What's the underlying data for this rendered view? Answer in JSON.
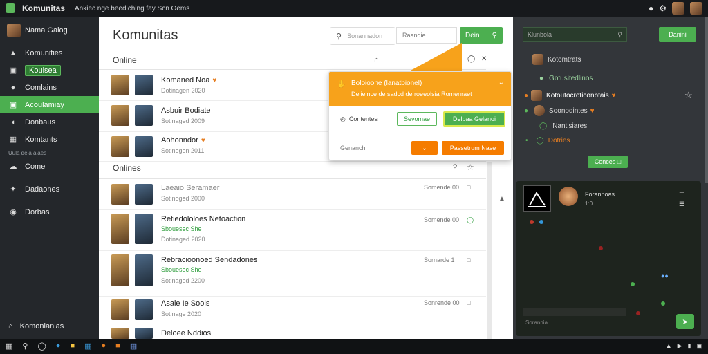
{
  "titlebar": {
    "app_name": "Komunitas",
    "tagline": "Ankiec nge beediching fay Scn Oems"
  },
  "sidebar": {
    "user_name": "Nama Galog",
    "items": [
      {
        "label": "Komunities",
        "icon": "trophy-icon"
      },
      {
        "label": "Koulsea",
        "icon": "chat-icon",
        "style": "pill"
      },
      {
        "label": "Comlains",
        "icon": "circle-icon"
      },
      {
        "label": "Acoulamiay",
        "icon": "message-icon",
        "style": "active"
      },
      {
        "label": "Donbaus",
        "icon": "gauge-icon"
      },
      {
        "label": "Komtants",
        "icon": "image-icon"
      },
      {
        "label": "Come",
        "icon": "cloud-icon"
      },
      {
        "label": "Dadaones",
        "icon": "settings-icon"
      },
      {
        "label": "Dorbas",
        "icon": "disc-icon"
      }
    ],
    "small_note": "Uula dela alaes",
    "footer_label": "Komonianias"
  },
  "main": {
    "title": "Komunitas",
    "search_placeholder": "Sonannadon",
    "filter_label": "Raandie",
    "done_label": "Dein",
    "online_header": "Online",
    "offline_header": "Onlines",
    "online_rows": [
      {
        "name": "Komaned Noa",
        "sub": "Dotinagen 2020"
      },
      {
        "name": "Asbuir Bodiate",
        "sub": "Sotinaged 2009"
      },
      {
        "name": "Aohonndor",
        "sub": "Sotinegen 2011"
      }
    ],
    "offline_rows": [
      {
        "name": "Laeaio Seramaer",
        "sub": "Sotinoged 2000",
        "status": "Somende 00",
        "faded": true
      },
      {
        "name": "Retiedololoes Netoaction",
        "green": "Sbouesec She",
        "sub": "Dotinaged 2020",
        "status": "Somende 00"
      },
      {
        "name": "Rebracioonoed Sendadones",
        "green": "Sbouesec She",
        "sub": "Sotinaged 2200",
        "status": "Sornarde 1"
      },
      {
        "name": "Asaie Ie Sools",
        "sub": "Sotinage 2020",
        "status": "Sonrende 00"
      },
      {
        "name": "Deloee Nddios",
        "sub": ""
      }
    ]
  },
  "popup": {
    "title": "Boloioone (lanatbionel)",
    "message": "Delieince de sadcd de roeeolsia Romenraet",
    "label": "Contentes",
    "btn_secondary": "Sevomae",
    "btn_primary": "Delbaa Gelanoi",
    "field_label": "Genanch",
    "btn_confirm": "Passetrum Nase"
  },
  "right": {
    "search_text": "Klunbola",
    "submit_label": "Danini",
    "members": [
      {
        "name": "Kotomtrats"
      },
      {
        "name": "Gotusitedlinos"
      },
      {
        "name": "Kotoutocroticonbtais"
      },
      {
        "name": "Soonodintes"
      },
      {
        "name": "Nantisiares"
      },
      {
        "name": "Dotries"
      }
    ],
    "add_label": "Conces"
  },
  "video": {
    "name": "Forannoas",
    "sub": "1:0 .",
    "input_placeholder": "Sorannia"
  },
  "colors": {
    "accent": "#4caf50",
    "warning": "#f7a21b",
    "orange": "#f57c00"
  }
}
